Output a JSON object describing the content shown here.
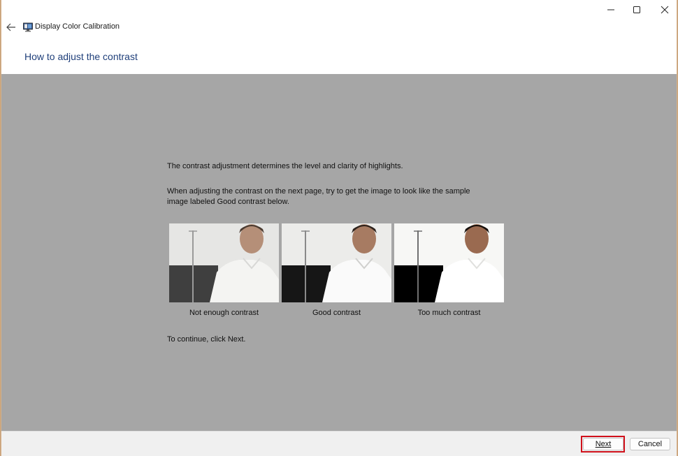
{
  "window": {
    "app_title": "Display Color Calibration",
    "page_title": "How to adjust the contrast",
    "controls": {
      "minimize": "minimize-icon",
      "maximize": "maximize-icon",
      "close": "close-icon"
    }
  },
  "content": {
    "intro": "The contrast adjustment determines the level and clarity of highlights.",
    "instruction_line1": "When adjusting the contrast on the next page, try to get the image to look like the sample",
    "instruction_line2": "image labeled Good contrast below.",
    "samples": [
      {
        "caption": "Not enough contrast",
        "dark_color": "#3f3f3f",
        "light_color": "#e6e6e4"
      },
      {
        "caption": "Good contrast",
        "dark_color": "#161616",
        "light_color": "#ececea"
      },
      {
        "caption": "Too much contrast",
        "dark_color": "#000000",
        "light_color": "#f7f7f5"
      }
    ],
    "continue_text": "To continue, click Next."
  },
  "footer": {
    "next_label": "Next",
    "cancel_label": "Cancel"
  },
  "colors": {
    "content_bg": "#a6a6a6",
    "title_blue": "#1f3f7a",
    "highlight_red": "#d0111b"
  }
}
